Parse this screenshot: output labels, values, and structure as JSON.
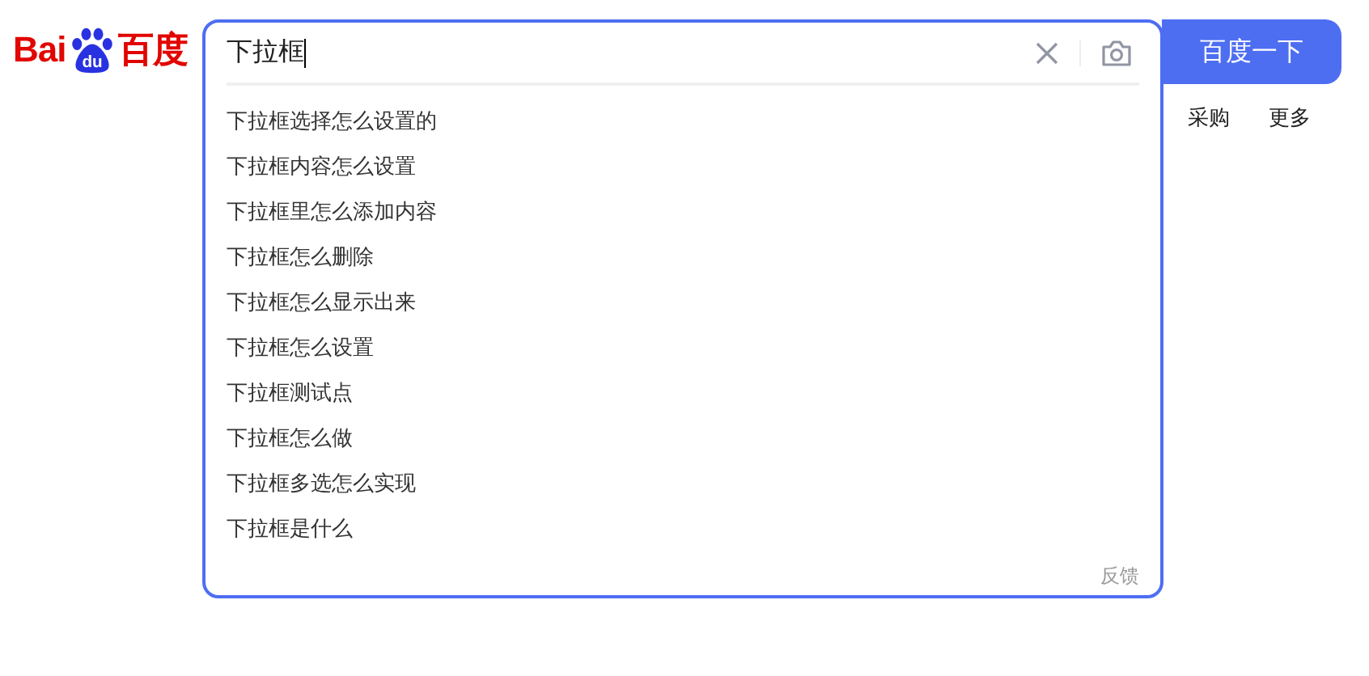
{
  "logo": {
    "left": "Bai",
    "paw": "du",
    "right": "百度"
  },
  "search": {
    "value": "下拉框",
    "button": "百度一下"
  },
  "nav": [
    "采购",
    "更多"
  ],
  "suggestions": [
    "下拉框选择怎么设置的",
    "下拉框内容怎么设置",
    "下拉框里怎么添加内容",
    "下拉框怎么删除",
    "下拉框怎么显示出来",
    "下拉框怎么设置",
    "下拉框测试点",
    "下拉框怎么做",
    "下拉框多选怎么实现",
    "下拉框是什么"
  ],
  "feedback": "反馈"
}
